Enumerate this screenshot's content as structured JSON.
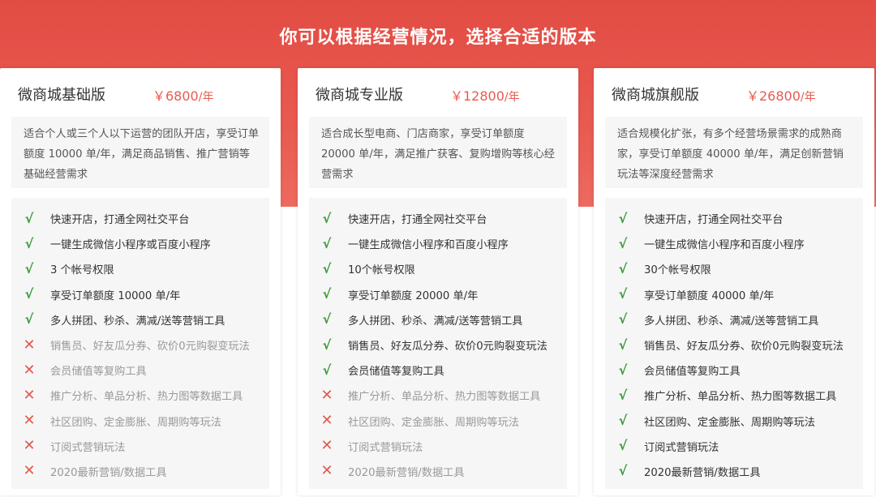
{
  "header": {
    "title": "你可以根据经营情况，选择合适的版本"
  },
  "colors": {
    "banner": "#e24c43",
    "price": "#e85a4f",
    "check": "#3a9a3a",
    "cross": "#e05a4f"
  },
  "plans": [
    {
      "name": "微商城基础版",
      "price": "￥6800",
      "unit": "/年",
      "description": "适合个人或三个人以下运营的团队开店，享受订单额度 10000 单/年，满足商品销售、推广营销等基础经营需求",
      "features": [
        {
          "text": "快速开店，打通全网社交平台",
          "included": true
        },
        {
          "text": "一键生成微信小程序或百度小程序",
          "included": true
        },
        {
          "text": "3 个帐号权限",
          "included": true
        },
        {
          "text": "享受订单额度 10000 单/年",
          "included": true
        },
        {
          "text": "多人拼团、秒杀、满减/送等营销工具",
          "included": true
        },
        {
          "text": "销售员、好友瓜分券、砍价0元购裂变玩法",
          "included": false
        },
        {
          "text": "会员储值等复购工具",
          "included": false
        },
        {
          "text": "推广分析、单品分析、热力图等数据工具",
          "included": false
        },
        {
          "text": "社区团购、定金膨胀、周期购等玩法",
          "included": false
        },
        {
          "text": "订阅式营销玩法",
          "included": false
        },
        {
          "text": "2020最新营销/数据工具",
          "included": false
        }
      ]
    },
    {
      "name": "微商城专业版",
      "price": "￥12800",
      "unit": "/年",
      "description": "适合成长型电商、门店商家，享受订单额度 20000 单/年，满足推广获客、复购增购等核心经营需求",
      "features": [
        {
          "text": "快速开店，打通全网社交平台",
          "included": true
        },
        {
          "text": "一键生成微信小程序和百度小程序",
          "included": true
        },
        {
          "text": "10个帐号权限",
          "included": true
        },
        {
          "text": "享受订单额度 20000 单/年",
          "included": true
        },
        {
          "text": "多人拼团、秒杀、满减/送等营销工具",
          "included": true
        },
        {
          "text": "销售员、好友瓜分券、砍价0元购裂变玩法",
          "included": true
        },
        {
          "text": "会员储值等复购工具",
          "included": true
        },
        {
          "text": "推广分析、单品分析、热力图等数据工具",
          "included": false
        },
        {
          "text": "社区团购、定金膨胀、周期购等玩法",
          "included": false
        },
        {
          "text": "订阅式营销玩法",
          "included": false
        },
        {
          "text": "2020最新营销/数据工具",
          "included": false
        }
      ]
    },
    {
      "name": "微商城旗舰版",
      "price": "￥26800",
      "unit": "/年",
      "description": "适合规模化扩张，有多个经营场景需求的成熟商家，享受订单额度 40000 单/年，满足创新营销玩法等深度经营需求",
      "features": [
        {
          "text": "快速开店，打通全网社交平台",
          "included": true
        },
        {
          "text": "一键生成微信小程序和百度小程序",
          "included": true
        },
        {
          "text": "30个帐号权限",
          "included": true
        },
        {
          "text": "享受订单额度 40000 单/年",
          "included": true
        },
        {
          "text": "多人拼团、秒杀、满减/送等营销工具",
          "included": true
        },
        {
          "text": "销售员、好友瓜分券、砍价0元购裂变玩法",
          "included": true
        },
        {
          "text": "会员储值等复购工具",
          "included": true
        },
        {
          "text": "推广分析、单品分析、热力图等数据工具",
          "included": true
        },
        {
          "text": "社区团购、定金膨胀、周期购等玩法",
          "included": true
        },
        {
          "text": "订阅式营销玩法",
          "included": true
        },
        {
          "text": "2020最新营销/数据工具",
          "included": true
        }
      ]
    }
  ],
  "icons": {
    "included": "√",
    "excluded": "✕"
  }
}
